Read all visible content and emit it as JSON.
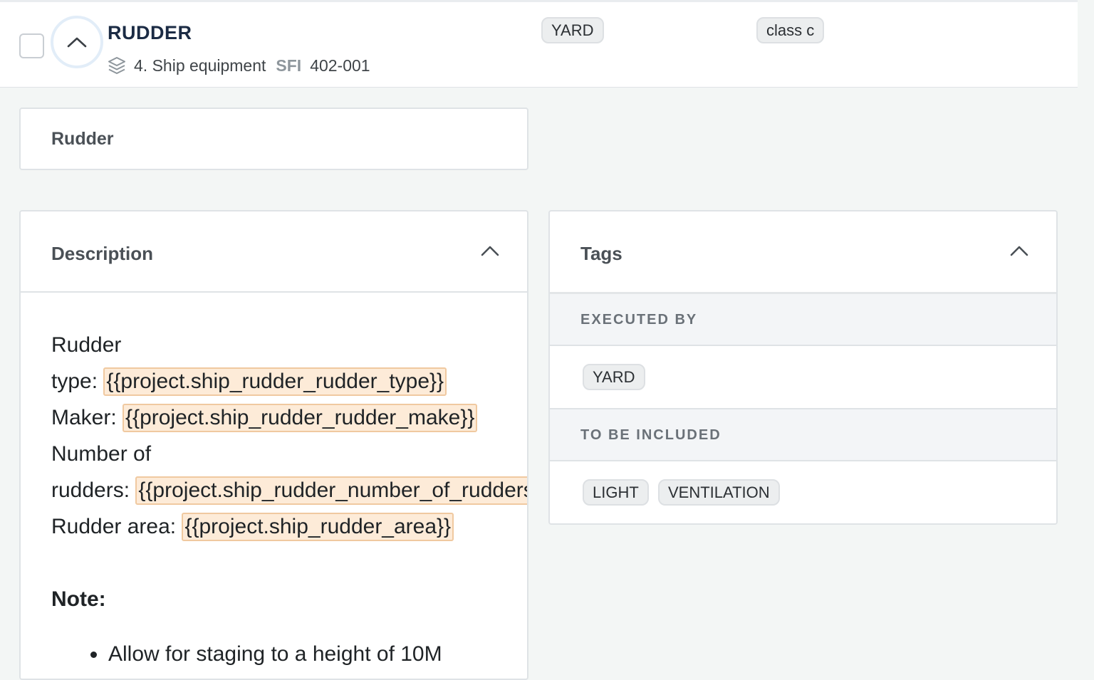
{
  "item": {
    "title": "RUDDER",
    "category": "4. Ship equipment",
    "sfi_label": "SFI",
    "sfi_code": "402-001",
    "tag_yard": "YARD",
    "tag_class": "class c"
  },
  "name_card": {
    "value": "Rudder"
  },
  "description": {
    "title": "Description",
    "line1": "Rudder",
    "line2_prefix": "type: ",
    "line2_tpl": "{{project.ship_rudder_rudder_type}}",
    "line3_prefix": "Maker: ",
    "line3_tpl": "{{project.ship_rudder_rudder_make}}",
    "line4": "Number of",
    "line5_prefix": "rudders: ",
    "line5_tpl": "{{project.ship_rudder_number_of_rudders}}",
    "line6_prefix": "Rudder area: ",
    "line6_tpl": "{{project.ship_rudder_area}}",
    "note_label": "Note:",
    "bullet1": "Allow for staging to a height of 10M"
  },
  "tags": {
    "title": "Tags",
    "executed_by_label": "EXECUTED BY",
    "executed_by": [
      "YARD"
    ],
    "to_be_included_label": "TO BE INCLUDED",
    "to_be_included": [
      "LIGHT",
      "VENTILATION"
    ]
  }
}
